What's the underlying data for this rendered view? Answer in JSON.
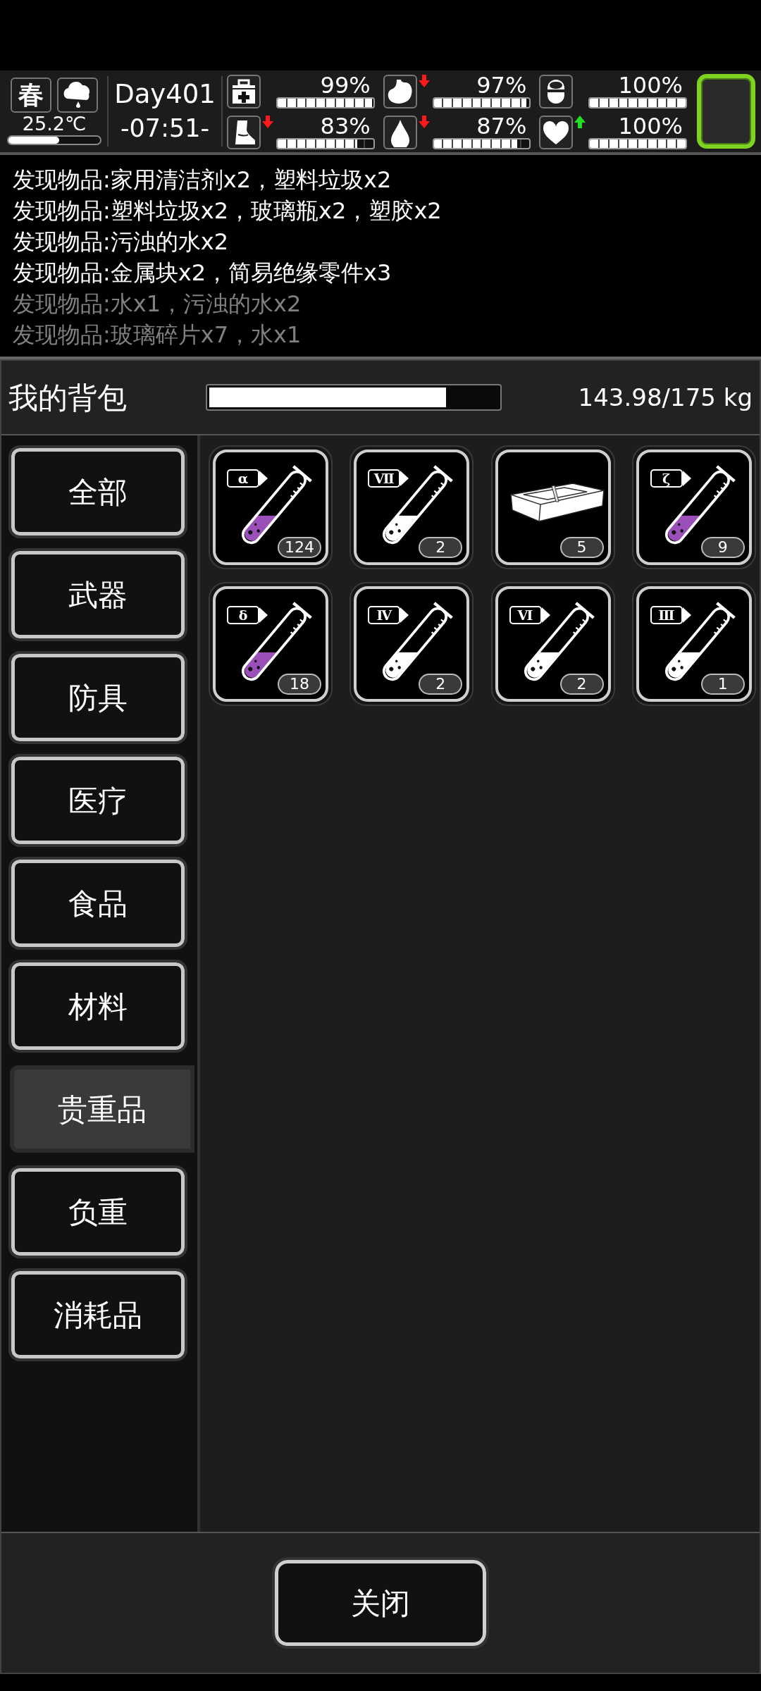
{
  "status_bar": {
    "season": "春",
    "temperature": {
      "reading": "25.2℃",
      "level": 0.55
    },
    "day": "Day401",
    "time": "-07:51-",
    "stats": [
      {
        "kind": "health",
        "reading": "99%",
        "level": 0.99,
        "falling": false,
        "rising": false
      },
      {
        "kind": "hunger",
        "reading": "97%",
        "level": 0.97,
        "falling": true,
        "rising": false
      },
      {
        "kind": "medicine",
        "reading": "100%",
        "level": 1.0,
        "falling": false,
        "rising": false
      },
      {
        "kind": "stamina",
        "reading": "83%",
        "level": 0.83,
        "falling": true,
        "rising": false
      },
      {
        "kind": "thirst",
        "reading": "87%",
        "level": 0.87,
        "falling": true,
        "rising": false
      },
      {
        "kind": "mood",
        "reading": "100%",
        "level": 1.0,
        "falling": false,
        "rising": true
      }
    ]
  },
  "log": [
    {
      "text": "发现物品:家用清洁剂x2，塑料垃圾x2",
      "dimmed": false
    },
    {
      "text": "发现物品:塑料垃圾x2，玻璃瓶x2，塑胶x2",
      "dimmed": false
    },
    {
      "text": "发现物品:污浊的水x2",
      "dimmed": false
    },
    {
      "text": "发现物品:金属块x2，简易绝缘零件x3",
      "dimmed": false
    },
    {
      "text": "发现物品:水x1，污浊的水x2",
      "dimmed": true
    },
    {
      "text": "发现物品:玻璃碎片x7，水x1",
      "dimmed": true
    }
  ],
  "backpack": {
    "title": "我的背包",
    "load": {
      "level": 0.82,
      "reading": "143.98/175 kg"
    },
    "categories": [
      {
        "label": "全部",
        "selected": false
      },
      {
        "label": "武器",
        "selected": false
      },
      {
        "label": "防具",
        "selected": false
      },
      {
        "label": "医疗",
        "selected": false
      },
      {
        "label": "食品",
        "selected": false
      },
      {
        "label": "材料",
        "selected": false
      },
      {
        "label": "贵重品",
        "selected": true
      },
      {
        "label": "负重",
        "selected": false
      },
      {
        "label": "消耗品",
        "selected": false
      }
    ],
    "items": [
      {
        "kind": "vial",
        "label": "α",
        "color": "#9b4fb8",
        "count": "124"
      },
      {
        "kind": "vial",
        "label": "Ⅶ",
        "color": "#ffffff",
        "count": "2"
      },
      {
        "kind": "cash",
        "count": "5"
      },
      {
        "kind": "vial",
        "label": "ζ",
        "color": "#9b4fb8",
        "count": "9"
      },
      {
        "kind": "vial",
        "label": "δ",
        "color": "#9b4fb8",
        "count": "18"
      },
      {
        "kind": "vial",
        "label": "Ⅳ",
        "color": "#ffffff",
        "count": "2"
      },
      {
        "kind": "vial",
        "label": "Ⅵ",
        "color": "#ffffff",
        "count": "2"
      },
      {
        "kind": "vial",
        "label": "Ⅲ",
        "color": "#ffffff",
        "count": "1"
      }
    ]
  },
  "close_button": "关闭"
}
